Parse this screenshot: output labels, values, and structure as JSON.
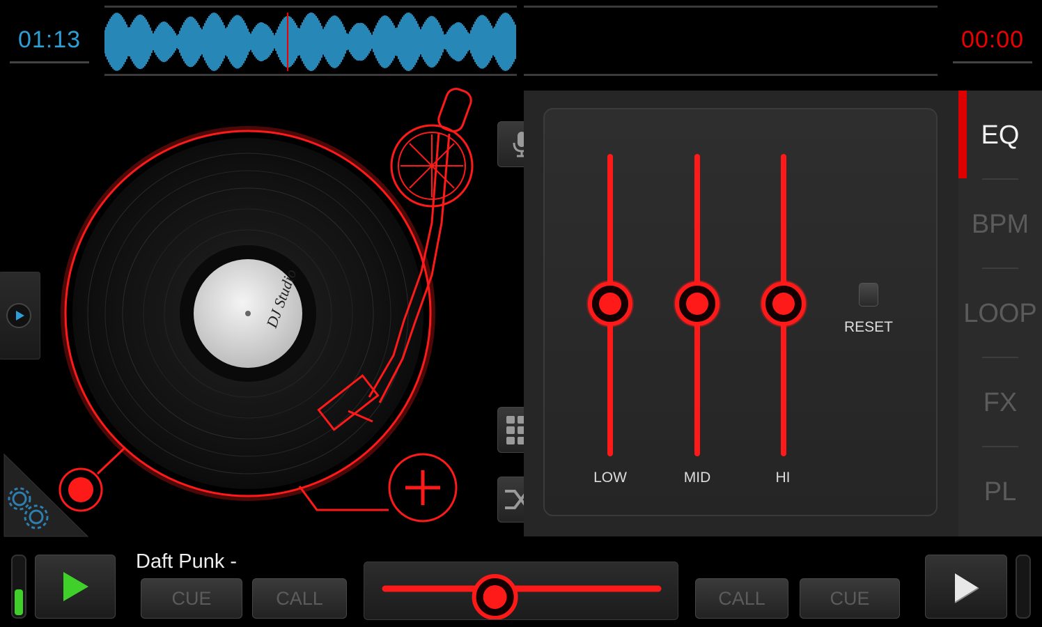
{
  "deck_a": {
    "elapsed_time": "01:13",
    "track_title": "Daft Punk -",
    "cue_label": "CUE",
    "call_label": "CALL",
    "record_label_text": "DJ Studio",
    "level": 0.45
  },
  "deck_b": {
    "elapsed_time": "00:00",
    "cue_label": "CUE",
    "call_label": "CALL"
  },
  "mixer": {
    "tabs": [
      {
        "label": "EQ",
        "active": true
      },
      {
        "label": "BPM",
        "active": false
      },
      {
        "label": "LOOP",
        "active": false
      },
      {
        "label": "FX",
        "active": false
      },
      {
        "label": "PL",
        "active": false
      }
    ],
    "eq": {
      "bands": [
        {
          "label": "LOW",
          "value": 0.5
        },
        {
          "label": "MID",
          "value": 0.5
        },
        {
          "label": "HI",
          "value": 0.5
        }
      ],
      "reset_label": "RESET"
    },
    "crossfader_value": 0.3
  },
  "colors": {
    "accent_red": "#ff1a1a",
    "deck_a_blue": "#2e9fd6",
    "deck_b_red": "#e00000",
    "level_green": "#3fd12a"
  },
  "icons": [
    "microphone-icon",
    "grid-icon",
    "shuffle-icon",
    "settings-gears-icon",
    "play-icon",
    "add-icon"
  ]
}
